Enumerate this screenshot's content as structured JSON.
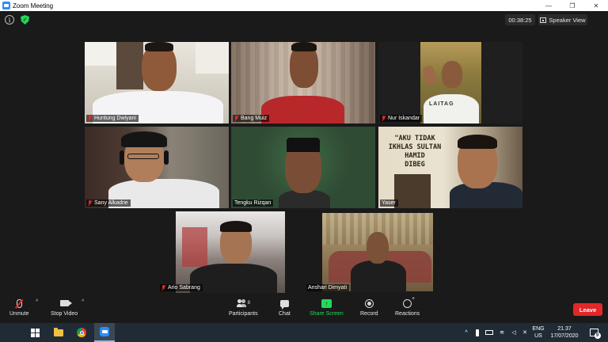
{
  "window": {
    "title": "Zoom Meeting",
    "minimize": "—",
    "maximize": "❐",
    "close": "✕"
  },
  "header": {
    "info": "i",
    "shield": "✓",
    "timer": "00:38:25",
    "view_label": "Speaker View"
  },
  "participants": [
    {
      "name": "Huntung Dwiyani",
      "muted": true
    },
    {
      "name": "Bang Muiz",
      "muted": true
    },
    {
      "name": "Nur Iskandar",
      "muted": true
    },
    {
      "name": "Sany Alkadrie",
      "muted": true
    },
    {
      "name": "Tengku Rizqan",
      "muted": false
    },
    {
      "name": "Yaser",
      "muted": false
    },
    {
      "name": "Ario Sabrang",
      "muted": true
    },
    {
      "name": "Anshari Dimyati",
      "muted": false
    }
  ],
  "poster_text": {
    "line1": "\"AKU TIDAK",
    "line2": "IKHLAS SULTAN",
    "line3": "HAMID",
    "line4": "DIBEG"
  },
  "shirt_text": "LAITAG",
  "toolbar": {
    "unmute": "Unmute",
    "stop_video": "Stop Video",
    "participants": "Participants",
    "participants_count": "8",
    "chat": "Chat",
    "share_screen": "Share Screen",
    "share_glyph": "↑",
    "record": "Record",
    "reactions": "Reactions",
    "leave": "Leave",
    "caret": "^"
  },
  "taskbar": {
    "tray_up": "^",
    "lang_top": "ENG",
    "lang_bottom": "US",
    "time": "21.37",
    "date": "17/07/2020",
    "notifications": "9"
  },
  "colors": {
    "accent": "#2d8cff",
    "leave": "#e02828",
    "share": "#23d959",
    "active_speaker": "#e6e03c"
  }
}
